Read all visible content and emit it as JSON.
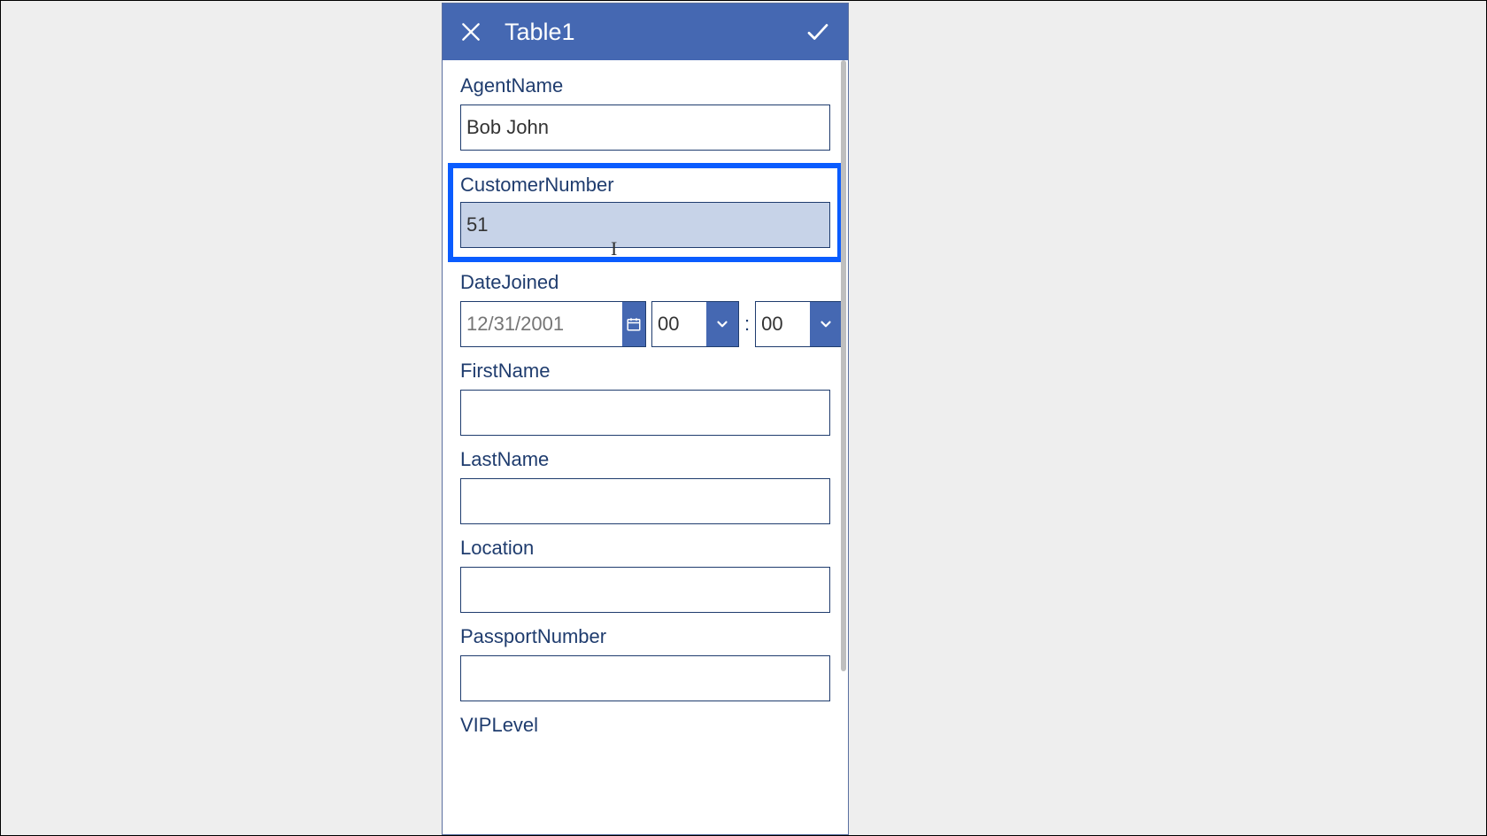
{
  "header": {
    "title": "Table1"
  },
  "form": {
    "fields": [
      {
        "label": "AgentName",
        "value": "Bob John",
        "highlighted": false,
        "type": "text"
      },
      {
        "label": "CustomerNumber",
        "value": "51",
        "highlighted": true,
        "type": "text"
      },
      {
        "label": "DateJoined",
        "datePlaceholder": "12/31/2001",
        "hour": "00",
        "minute": "00",
        "type": "datetime"
      },
      {
        "label": "FirstName",
        "value": "",
        "type": "text"
      },
      {
        "label": "LastName",
        "value": "",
        "type": "text"
      },
      {
        "label": "Location",
        "value": "",
        "type": "text"
      },
      {
        "label": "PassportNumber",
        "value": "",
        "type": "text"
      },
      {
        "label": "VIPLevel",
        "value": "",
        "type": "text"
      }
    ]
  },
  "icons": {
    "close": "close-icon",
    "confirm": "check-icon",
    "calendar": "calendar-icon",
    "chevron": "chevron-down-icon"
  },
  "colors": {
    "headerBg": "#4568b2",
    "labelColor": "#1f3c6e",
    "highlightBorder": "#0a5cff",
    "highlightFill": "#c7d3e8",
    "pageBg": "#eeeeee"
  }
}
